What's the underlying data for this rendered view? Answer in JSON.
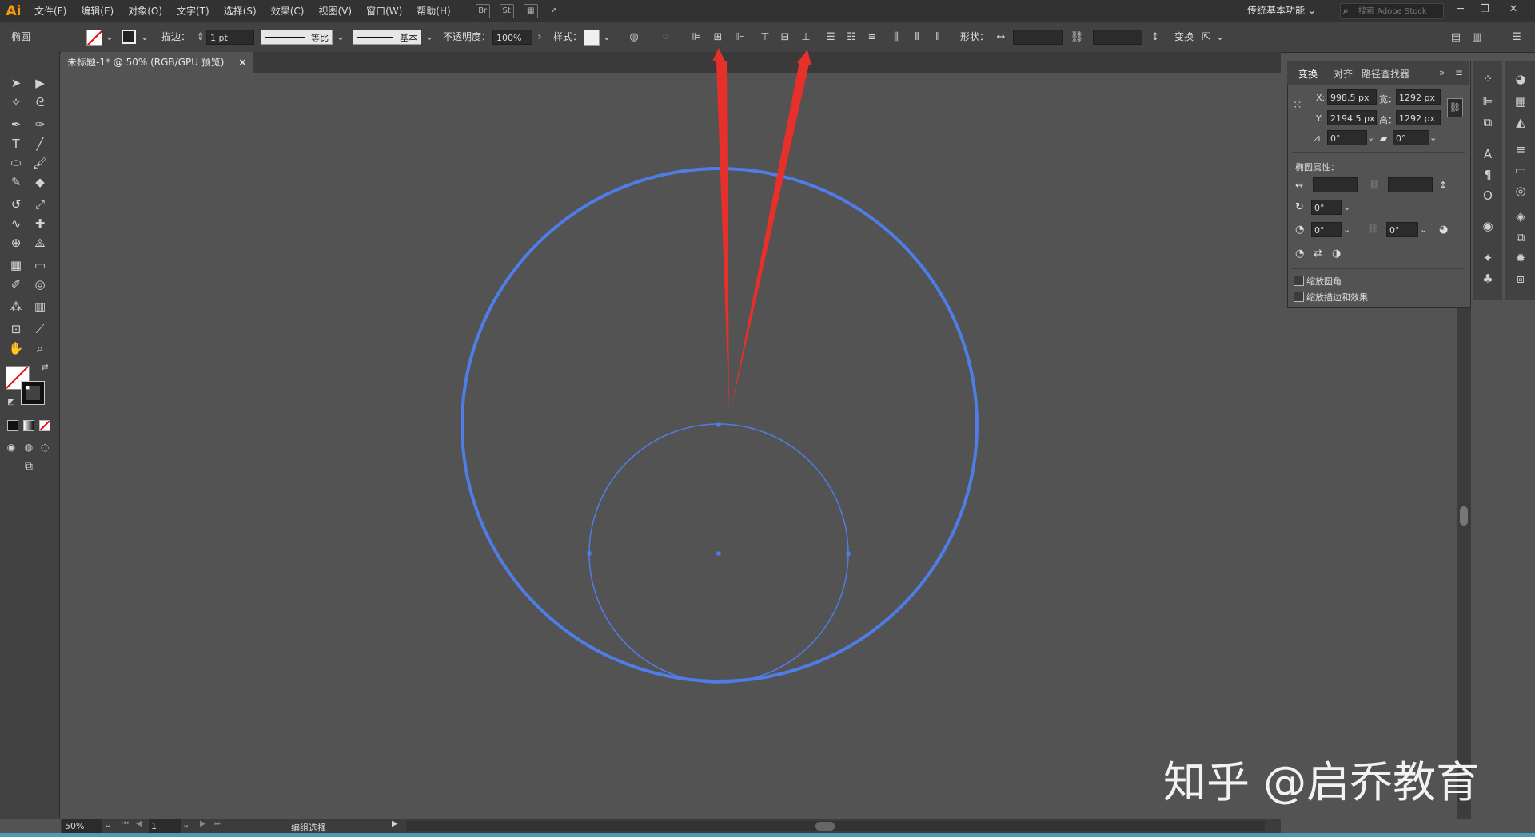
{
  "app": {
    "logo": "Ai",
    "workspace": "传统基本功能",
    "search_placeholder": "搜索 Adobe Stock"
  },
  "menu": [
    "文件(F)",
    "编辑(E)",
    "对象(O)",
    "文字(T)",
    "选择(S)",
    "效果(C)",
    "视图(V)",
    "窗口(W)",
    "帮助(H)"
  ],
  "menu_icons": {
    "br": "Br",
    "st": "St"
  },
  "control": {
    "object_type": "椭圆",
    "stroke_label": "描边：",
    "stroke_weight": "1 pt",
    "profile_label": "等比",
    "brush_label": "基本",
    "opacity_label": "不透明度：",
    "opacity_value": "100%",
    "style_label": "样式：",
    "shape_label": "形状：",
    "transform_label": "变换"
  },
  "document": {
    "tab_title": "未标题-1* @ 50% (RGB/GPU 预览)",
    "close": "×"
  },
  "transform_panel": {
    "tabs": [
      "变换",
      "对齐",
      "路径查找器"
    ],
    "x_label": "X:",
    "x_value": "998.5 px",
    "y_label": "Y:",
    "y_value": "2194.5 px",
    "w_label": "宽：",
    "w_value": "1292 px",
    "h_label": "高：",
    "h_value": "1292 px",
    "rotate_value": "0°",
    "shear_value": "0°",
    "ellipse_props": "椭圆属性：",
    "pie_start": "0°",
    "pie_end": "0°",
    "angle_value": "0°",
    "scale_corners": "缩放圆角",
    "scale_strokes": "缩放描边和效果"
  },
  "status": {
    "zoom": "50%",
    "artboard": "1",
    "mode": "编组选择"
  },
  "watermark": "知乎 @启乔教育",
  "colors": {
    "ellipse_stroke": "#4f7de8",
    "arrow": "#e8302a",
    "canvas": "#535353"
  }
}
